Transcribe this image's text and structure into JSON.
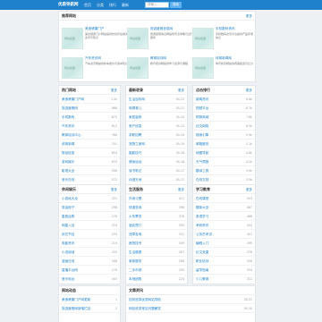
{
  "header": {
    "brand": "优质导航网",
    "nav": [
      "首页",
      "分类",
      "排行",
      "最新",
      "专题"
    ],
    "search_placeholder": "请输入...",
    "search_button": "搜索"
  },
  "featured": {
    "title": "推荐网站",
    "more": "更多",
    "items": [
      {
        "image_label": "网站截图",
        "name": "美食健康门户",
        "desc": "美食健康门户网站提供饮食养生相关资讯与知识"
      },
      {
        "image_label": "网站截图",
        "name": "旅游度假信息网",
        "desc": "旅游度假信息网提供景点攻略与出行服务"
      },
      {
        "image_label": "网站截图",
        "name": "手机数码资讯",
        "desc": "手机数码资讯平台提供产品评测信息"
      },
      {
        "image_label": "网站截图",
        "name": "汽车资讯网",
        "desc": "汽车资讯网提供新车报价与用车知识"
      },
      {
        "image_label": "网站截图",
        "name": "教育培训网",
        "desc": "教育培训网提供学习资源与课程"
      },
      {
        "image_label": "网站截图",
        "name": "体育新闻网",
        "desc": "体育新闻网提供赛事报道与比分"
      }
    ]
  },
  "lists_row1": [
    {
      "title": "热门网站",
      "more": "更多",
      "items": [
        {
          "name": "美食健康门户网",
          "meta": "1.2k"
        },
        {
          "name": "旅游度假网",
          "meta": "986"
        },
        {
          "name": "手机数码",
          "meta": "875"
        },
        {
          "name": "汽车资讯",
          "meta": "812"
        },
        {
          "name": "教育培训中心",
          "meta": "766"
        },
        {
          "name": "体育新闻",
          "meta": "701"
        },
        {
          "name": "财经信息",
          "meta": "654"
        },
        {
          "name": "游戏娱乐",
          "meta": "633"
        },
        {
          "name": "影视大全",
          "meta": "598"
        },
        {
          "name": "音乐在线",
          "meta": "572"
        }
      ]
    },
    {
      "title": "最新收录",
      "more": "更多",
      "items": [
        {
          "name": "生活百科网",
          "meta": "05-21"
        },
        {
          "name": "母婴育儿",
          "meta": "05-21"
        },
        {
          "name": "家居装修",
          "meta": "05-20"
        },
        {
          "name": "房产信息",
          "meta": "05-20"
        },
        {
          "name": "求职招聘",
          "meta": "05-19"
        },
        {
          "name": "宠物之家网",
          "meta": "05-19"
        },
        {
          "name": "摄影技巧",
          "meta": "05-18"
        },
        {
          "name": "健身运动",
          "meta": "05-18"
        },
        {
          "name": "读书笔记",
          "meta": "05-17"
        },
        {
          "name": "动漫天地",
          "meta": "05-17"
        }
      ]
    },
    {
      "title": "点击排行",
      "more": "更多",
      "items": [
        {
          "name": "新闻资讯",
          "meta": "9.8k"
        },
        {
          "name": "视频平台",
          "meta": "8.7k"
        },
        {
          "name": "购物商城",
          "meta": "7.6k"
        },
        {
          "name": "社交网络",
          "meta": "6.5k"
        },
        {
          "name": "搜索引擎",
          "meta": "5.9k"
        },
        {
          "name": "邮箱服务",
          "meta": "5.1k"
        },
        {
          "name": "地图导航",
          "meta": "4.8k"
        },
        {
          "name": "天气预报",
          "meta": "4.2k"
        },
        {
          "name": "翻译工具",
          "meta": "3.9k"
        },
        {
          "name": "在线文档",
          "meta": "3.5k"
        }
      ]
    }
  ],
  "lists_row2": [
    {
      "title": "休闲娱乐",
      "more": "更多",
      "items": [
        {
          "name": "小游戏大全",
          "meta": "321"
        },
        {
          "name": "笑话段子",
          "meta": "298"
        },
        {
          "name": "星座运势",
          "meta": "276"
        },
        {
          "name": "明星八卦",
          "meta": "254"
        },
        {
          "name": "综艺节目",
          "meta": "233"
        },
        {
          "name": "电影资讯",
          "meta": "219"
        },
        {
          "name": "小说阅读",
          "meta": "205"
        },
        {
          "name": "漫画在线",
          "meta": "188"
        },
        {
          "name": "直播平台网",
          "meta": "176"
        },
        {
          "name": "音乐电台",
          "meta": "163"
        }
      ]
    },
    {
      "title": "生活服务",
      "more": "更多",
      "items": [
        {
          "name": "外卖订餐",
          "meta": "412"
        },
        {
          "name": "快递查询",
          "meta": "398"
        },
        {
          "name": "火车票务",
          "meta": "376"
        },
        {
          "name": "酒店预订",
          "meta": "355"
        },
        {
          "name": "违章查询",
          "meta": "331"
        },
        {
          "name": "医院挂号",
          "meta": "309"
        },
        {
          "name": "生活缴费",
          "meta": "287"
        },
        {
          "name": "家政服务",
          "meta": "266"
        },
        {
          "name": "二手市场",
          "meta": "245"
        },
        {
          "name": "本地团购",
          "meta": "224"
        }
      ]
    },
    {
      "title": "学习教育",
      "more": "更多",
      "items": [
        {
          "name": "在线课堂",
          "meta": "503"
        },
        {
          "name": "题库大全",
          "meta": "487"
        },
        {
          "name": "英语学习",
          "meta": "466"
        },
        {
          "name": "考研资讯",
          "meta": "444"
        },
        {
          "name": "公务员考试",
          "meta": "421"
        },
        {
          "name": "编程入门",
          "meta": "399"
        },
        {
          "name": "论文查重",
          "meta": "378"
        },
        {
          "name": "职业培训",
          "meta": "356"
        },
        {
          "name": "留学指南",
          "meta": "334"
        },
        {
          "name": "少儿教育",
          "meta": "312"
        }
      ]
    }
  ],
  "lists_row3": [
    {
      "title": "网站动态",
      "items": [
        {
          "name": "美食健康门户网更新",
          "meta": "1"
        },
        {
          "name": "旅游度假网新增栏目",
          "meta": "2"
        }
      ]
    },
    {
      "title": "文章资讯",
      "items": [
        {
          "name": "如何选择优质网站导航",
          "meta": "05-21"
        },
        {
          "name": "网站收录常见问题解答",
          "meta": "05-20"
        }
      ]
    }
  ]
}
